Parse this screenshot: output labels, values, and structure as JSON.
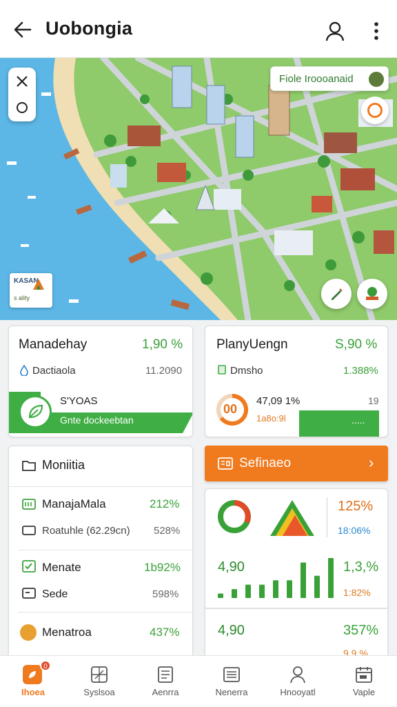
{
  "header": {
    "title": "Uobongia"
  },
  "map": {
    "tag_label": "Fiole Iroooanaid",
    "logo_line1": "KASAN",
    "logo_line2": "s ality"
  },
  "card1": {
    "title": "Manadehay",
    "value": "1,90 %",
    "sub_label": "Dactiaola",
    "sub_value": "11.2090",
    "chip_label": "S'YOAS",
    "bar_label": "Gnte dockeebtan"
  },
  "card2": {
    "title": "PlanyUengn",
    "value": "S,90 %",
    "sub_label": "Dmsho",
    "sub_value": "1.388%",
    "gauge_text": "00",
    "stat_label": "47,09 1%",
    "stat_small": "1a8o:9l",
    "stat_right": "19"
  },
  "list": {
    "header": "Moniitia",
    "rows": [
      {
        "label": "ManajaMala",
        "value": "212%"
      },
      {
        "label": "Roatuhle (62.29cn)",
        "value": "528%"
      },
      {
        "label": "Menate",
        "value": "1b92%"
      },
      {
        "label": "Sede",
        "value": "598%"
      },
      {
        "label": "Menatroa",
        "value": "437%"
      }
    ]
  },
  "cta": {
    "label": "Sefinaeo",
    "arrow": "›"
  },
  "analytics": {
    "row1_value": "125%",
    "row1_sub": "18:06%",
    "row2_left": "4,90",
    "row2_value": "1,3,%",
    "row2_sub": "1:82%",
    "row3_left": "4,90",
    "row3_value": "357%",
    "row3_sub": "9,9.%"
  },
  "chart_data": {
    "type": "bar",
    "categories": [
      "1",
      "2",
      "3",
      "4",
      "5",
      "6",
      "7",
      "8",
      "9"
    ],
    "values": [
      1,
      2,
      3,
      3,
      4,
      4,
      8,
      5,
      9
    ]
  },
  "nav": {
    "items": [
      {
        "label": "Ihoea",
        "icon": "home-icon",
        "active": true
      },
      {
        "label": "Syslsoa",
        "icon": "map-icon"
      },
      {
        "label": "Aenrra",
        "icon": "document-icon"
      },
      {
        "label": "Nenerra",
        "icon": "list-icon"
      },
      {
        "label": "Hnooyatl",
        "icon": "profile-icon"
      },
      {
        "label": "Vaple",
        "icon": "calendar-icon"
      }
    ],
    "badge": "0"
  },
  "colors": {
    "accent": "#f07a1e",
    "green": "#3aa139",
    "red": "#e14b2a"
  }
}
